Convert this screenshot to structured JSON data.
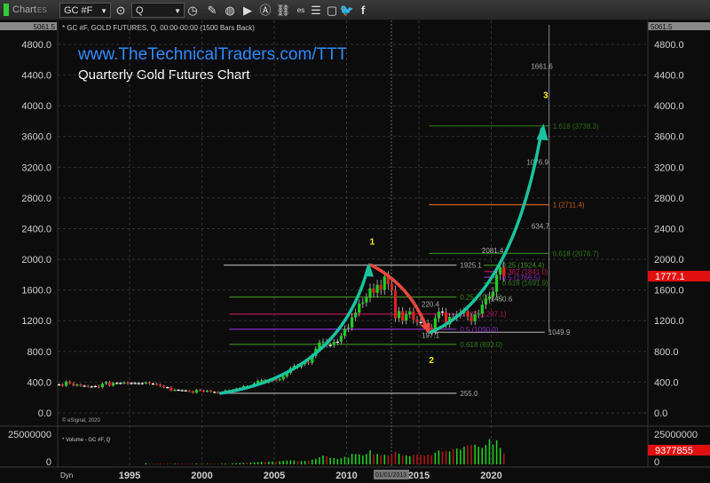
{
  "toolbar": {
    "window_label": "Chart",
    "symbol": "GC #F",
    "interval": "Q",
    "badge": "ES"
  },
  "chart_header": "* GC #F, GOLD FUTURES, Q, 00:00-00:00 (1500 Bars Back)",
  "top_price_tag": "5061.5",
  "title": "www.TheTechnicalTraders.com/TTT",
  "subtitle": "Quarterly Gold Futures Chart",
  "copyright": "© eSignal, 2020",
  "volume_header": "* Volume - GC #F, Q",
  "dyn_label": "Dyn",
  "date_marker": "01/01/2013",
  "last_price": "1777.1",
  "last_volume": "9377855",
  "colors": {
    "up": "#22cc22",
    "down": "#dd2222",
    "arrow_up": "#19c4a0",
    "arrow_down": "#f0483e",
    "title": "#2f8cff"
  },
  "chart_data": {
    "type": "candlestick",
    "price_ticks": [
      "0.0",
      "400.0",
      "800.0",
      "1200.0",
      "1600.0",
      "2000.0",
      "2400.0",
      "2800.0",
      "3200.0",
      "3600.0",
      "4000.0",
      "4400.0",
      "4800.0"
    ],
    "year_ticks": [
      "1995",
      "2000",
      "2005",
      "2010",
      "2015",
      "2020"
    ],
    "volume_ticks": [
      "25000000",
      "0"
    ],
    "start_year": 1990,
    "quarterly_close": [
      370,
      352,
      408,
      386,
      356,
      368,
      354,
      353,
      344,
      343,
      349,
      333,
      380,
      400,
      355,
      390,
      390,
      385,
      395,
      383,
      390,
      387,
      384,
      387,
      396,
      382,
      379,
      369,
      351,
      334,
      332,
      290,
      301,
      296,
      293,
      288,
      279,
      261,
      299,
      290,
      278,
      288,
      273,
      272,
      258,
      270,
      293,
      279,
      301,
      318,
      323,
      348,
      334,
      346,
      385,
      417,
      427,
      395,
      418,
      438,
      428,
      437,
      473,
      518,
      583,
      614,
      599,
      635,
      663,
      650,
      743,
      834,
      916,
      930,
      884,
      884,
      924,
      927,
      1003,
      1096,
      1113,
      1245,
      1307,
      1421,
      1439,
      1500,
      1620,
      1565,
      1668,
      1604,
      1776,
      1675,
      1595,
      1234,
      1326,
      1201,
      1283,
      1322,
      1211,
      1184,
      1183,
      1171,
      1114,
      1060,
      1232,
      1320,
      1313,
      1151,
      1249,
      1241,
      1280,
      1302,
      1323,
      1253,
      1192,
      1281,
      1292,
      1409,
      1485,
      1517,
      1577,
      1800,
      1895,
      1777
    ],
    "quarterly_volume_millions": [
      0,
      0,
      0,
      0,
      0,
      0,
      0,
      0,
      0,
      0,
      0,
      0,
      0,
      0,
      0,
      0,
      0,
      0,
      0,
      0,
      0,
      0,
      0,
      0,
      0.9,
      0.6,
      0.5,
      0.6,
      0.6,
      0.5,
      0.6,
      0.5,
      0.5,
      0.5,
      0.6,
      0.5,
      0.5,
      0.5,
      0.7,
      0.6,
      0.5,
      0.5,
      0.6,
      0.5,
      0.5,
      0.5,
      0.6,
      0.6,
      0.8,
      1.0,
      1.1,
      1.3,
      1.5,
      1.6,
      1.8,
      2.0,
      2.2,
      2.0,
      2.3,
      2.5,
      2.5,
      2.7,
      3.0,
      3.2,
      3.5,
      3.4,
      3.0,
      2.8,
      3.0,
      3.3,
      4.0,
      4.8,
      6.0,
      7.5,
      7.0,
      5.5,
      5.3,
      4.5,
      5.2,
      6.5,
      5.8,
      9.0,
      8.7,
      8.5,
      7.5,
      8.8,
      12.0,
      8.5,
      8.8,
      7.7,
      8.2,
      7.5,
      8.0,
      11.0,
      9.0,
      7.5,
      7.6,
      7.0,
      8.0,
      8.4,
      8.0,
      7.3,
      8.4,
      7.6,
      10.0,
      11.8,
      11.0,
      11.5,
      11.0,
      12.8,
      13.5,
      12.5,
      15.0,
      16.0,
      16.5,
      16.8,
      15.0,
      14.0,
      16.5,
      21.5,
      17.0,
      20.5,
      14.0,
      9.38
    ],
    "levels": [
      {
        "price": 1925.1,
        "from": 2001.5,
        "to": 2017.6,
        "color": "#9a9a9a",
        "label": "1925.1"
      },
      {
        "price": 255.0,
        "from": 2001.5,
        "to": 2017.6,
        "color": "#9a9a9a",
        "label": "255.0"
      },
      {
        "price": 1049.9,
        "from": 2015.7,
        "to": 2023.7,
        "color": "#9a9a9a",
        "label": "1049.9"
      },
      {
        "price": 1509.5,
        "from": 2001.9,
        "to": 2017.6,
        "color": "#3c8a1c",
        "label": "0.25 (1509.5)"
      },
      {
        "price": 1287.1,
        "from": 2001.9,
        "to": 2017.6,
        "color": "#b0155a",
        "label": "0.382 (1287.1)"
      },
      {
        "price": 1090.0,
        "from": 2001.9,
        "to": 2017.6,
        "color": "#8a2ac0",
        "label": "0.5 (1090.0)"
      },
      {
        "price": 893.0,
        "from": 2001.9,
        "to": 2017.6,
        "color": "#2f7a14",
        "label": "0.618 (893.0)"
      },
      {
        "price": 2076.7,
        "from": 2015.7,
        "to": 2024.0,
        "color": "#2f7a14",
        "label": "0.618 (2076.7)"
      },
      {
        "price": 2711.4,
        "from": 2015.7,
        "to": 2024.0,
        "color": "#c85a16",
        "label": "1 (2711.4)"
      },
      {
        "price": 3738.3,
        "from": 2015.7,
        "to": 2024.0,
        "color": "#2a6a14",
        "label": "1.618 (3738.3)"
      },
      {
        "price": 1924.4,
        "from": 2019.5,
        "to": 2020.5,
        "color": "#3c8a1c",
        "label": "0.25 (1924.4)"
      },
      {
        "price": 1841.0,
        "from": 2019.5,
        "to": 2020.5,
        "color": "#b0155a",
        "label": "0.382 (1841.0)"
      },
      {
        "price": 1766.5,
        "from": 2019.5,
        "to": 2020.5,
        "color": "#8a2ac0",
        "label": "0.5 (1766.5)"
      },
      {
        "price": 1691.9,
        "from": 2019.5,
        "to": 2020.5,
        "color": "#2f7a14",
        "label": "0.618 (1691.9)"
      }
    ],
    "measure_labels": [
      {
        "year": 2023.5,
        "price": 4480,
        "label": "1661.6"
      },
      {
        "year": 2023.2,
        "price": 3230,
        "label": "1076.9"
      },
      {
        "year": 2023.4,
        "price": 2400,
        "label": "634.7"
      },
      {
        "year": 2020.1,
        "price": 2081.4,
        "label": "2081.4"
      },
      {
        "year": 2020.7,
        "price": 1450.6,
        "label": "1450.6"
      },
      {
        "year": 2015.8,
        "price": 1380,
        "label": "220.4"
      },
      {
        "year": 2015.8,
        "price": 980,
        "label": "197.1"
      }
    ],
    "wave_labels": [
      {
        "label": "1",
        "year": 2011.6,
        "price": 2190
      },
      {
        "label": "2",
        "year": 2015.7,
        "price": 650
      },
      {
        "label": "3",
        "year": 2023.6,
        "price": 4100
      }
    ]
  }
}
